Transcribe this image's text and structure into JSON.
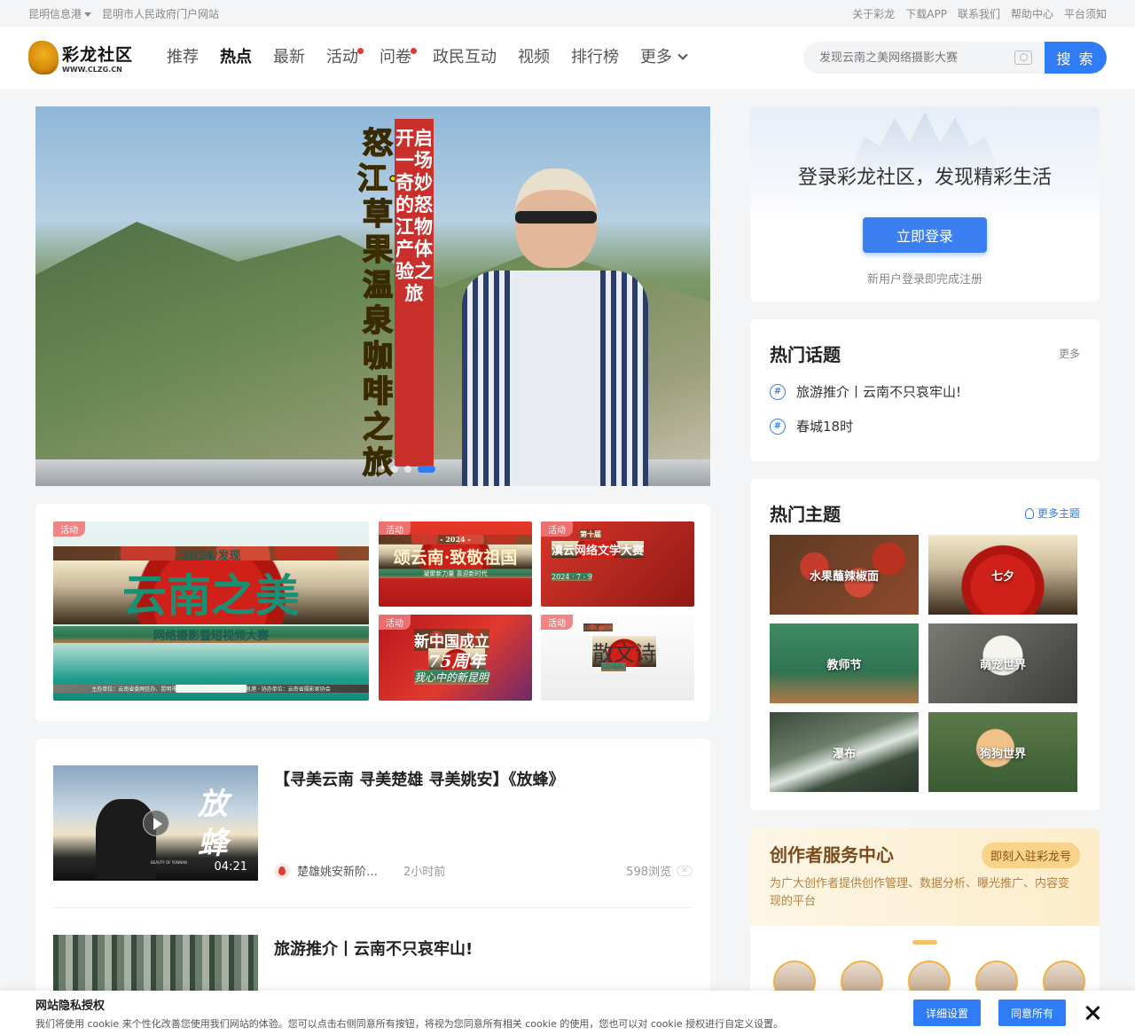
{
  "topbar": {
    "left": [
      "昆明信息港",
      "昆明市人民政府门户网站"
    ],
    "right": [
      "关于彩龙",
      "下载APP",
      "联系我们",
      "帮助中心",
      "平台须知"
    ]
  },
  "logo": {
    "cn": "彩龙社区",
    "en": "WWW.CLZG.CN"
  },
  "nav": [
    {
      "label": "推荐",
      "active": false,
      "dot": false
    },
    {
      "label": "热点",
      "active": true,
      "dot": false
    },
    {
      "label": "最新",
      "active": false,
      "dot": false
    },
    {
      "label": "活动",
      "active": false,
      "dot": true
    },
    {
      "label": "问卷",
      "active": false,
      "dot": true
    },
    {
      "label": "政民互动",
      "active": false,
      "dot": false
    },
    {
      "label": "视频",
      "active": false,
      "dot": false
    },
    {
      "label": "排行榜",
      "active": false,
      "dot": false
    },
    {
      "label": "更多",
      "active": false,
      "dot": false
    }
  ],
  "search": {
    "placeholder": "发现云南之美网络摄影大赛",
    "button": "搜 索"
  },
  "banner": {
    "title": "怒江·草果温泉咖啡之旅",
    "subtitle": "开启一场奇妙的怒江物产体验之旅"
  },
  "activities": {
    "tag": "活动",
    "a1": {
      "line1": "2024/发现",
      "line2": "云南之美",
      "line3": "网络摄影暨短视频大赛",
      "line4": "主办单位：云南省委网信办、昆明市委宣传部 · 承办单位：昆明信息港 · 协办单位：云南省摄影家协会"
    },
    "a2": {
      "line1": "- 2024 -",
      "line2": "颂云南·致敬祖国",
      "line3": "凝聚新力量 喜迎新时代"
    },
    "a3": {
      "line1": "第十届",
      "line2": "滇云网络文学大赛",
      "line3": "2024 · 7 - 9"
    },
    "a4": {
      "line1": "新中国成立",
      "line2": "75周年",
      "line3": "我心中的新昆明"
    },
    "a5": {
      "line1": "2024 · 网络",
      "line2": "散文诗",
      "line3": "网络大赛"
    }
  },
  "feed": [
    {
      "title": "【寻美云南 寻美楚雄 寻美姚安】《放蜂》",
      "thumb_text": "放蜂",
      "caption": "BEAUTY OF YUNNAN",
      "duration": "04:21",
      "author": "楚雄姚安新阶层人士",
      "time": "2小时前",
      "views": "598浏览"
    },
    {
      "title": "旅游推介丨云南不只哀牢山!"
    }
  ],
  "login": {
    "title": "登录彩龙社区，发现精彩生活",
    "button": "立即登录",
    "hint": "新用户登录即完成注册"
  },
  "hot_topics": {
    "title": "热门话题",
    "more": "更多",
    "items": [
      "旅游推介丨云南不只哀牢山!",
      "春城18时"
    ]
  },
  "hot_themes": {
    "title": "热门主题",
    "more": "更多主题",
    "items": [
      "水果蘸辣椒面",
      "七夕",
      "教师节",
      "萌宠世界",
      "瀑布",
      "狗狗世界"
    ]
  },
  "creator": {
    "title": "创作者服务中心",
    "button": "即刻入驻彩龙号",
    "desc": "为广大创作者提供创作管理、数据分析、曝光推广、内容变现的平台"
  },
  "cookie": {
    "title": "网站隐私授权",
    "desc": "我们将使用 cookie 来个性化改善您使用我们网站的体验。您可以点击右侧同意所有按钮，将视为您同意所有相关 cookie 的使用，您也可以对 cookie 授权进行自定义设置。",
    "settings": "详细设置",
    "accept": "同意所有"
  }
}
